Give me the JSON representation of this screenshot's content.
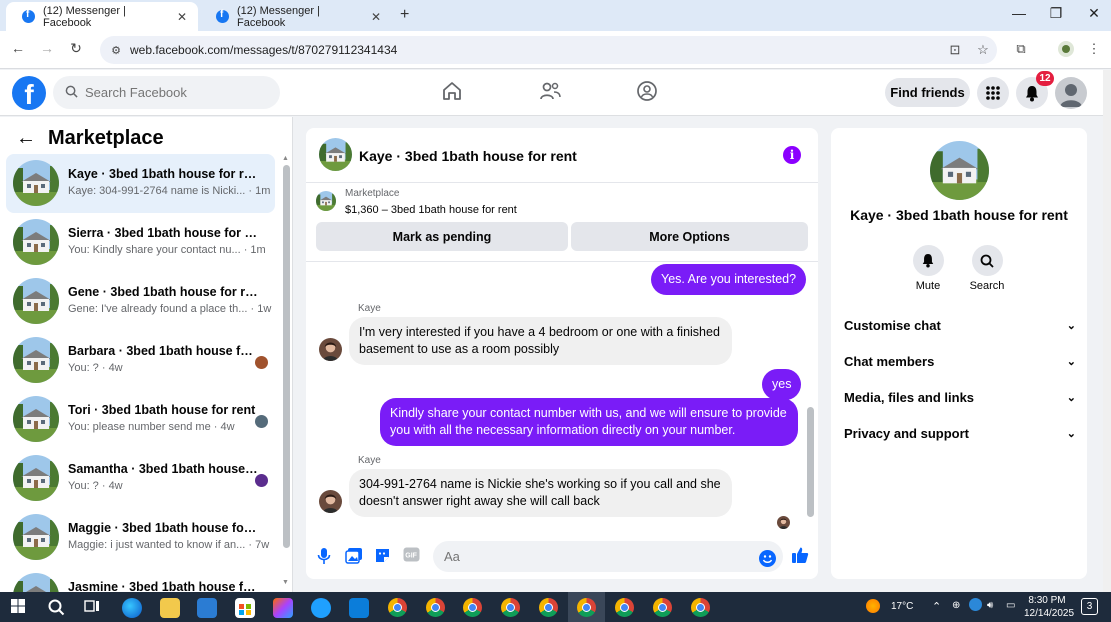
{
  "browser": {
    "tabs": [
      {
        "title": "(12) Messenger | Facebook",
        "close": "✕"
      },
      {
        "title": "(12) Messenger | Facebook",
        "close": "✕"
      }
    ],
    "new_tab": "+",
    "url": "web.facebook.com/messages/t/870279112341434",
    "window_controls": {
      "minimize": "—",
      "restore": "❐",
      "close": "✕"
    }
  },
  "header": {
    "logo": "f",
    "search_placeholder": "Search Facebook",
    "find_friends": "Find friends",
    "notifications_count": "12"
  },
  "sidebar": {
    "title": "Marketplace",
    "conversations": [
      {
        "name": "Kaye · 3bed 1bath house for rent",
        "snippet": "Kaye: 304-991-2764 name is Nicki... · 1m",
        "selected": true
      },
      {
        "name": "Sierra · 3bed 1bath house for rent",
        "snippet": "You: Kindly share your contact nu... · 1m"
      },
      {
        "name": "Gene · 3bed 1bath house for rent",
        "snippet": "Gene: I've already found a place th... · 1w"
      },
      {
        "name": "Barbara · 3bed 1bath house fo...",
        "snippet": "You: ? · 4w",
        "seen_color": "#a0522d"
      },
      {
        "name": "Tori · 3bed 1bath house for rent",
        "snippet": "You: please number send me · 4w",
        "seen_color": "#556b7a"
      },
      {
        "name": "Samantha · 3bed 1bath house ...",
        "snippet": "You: ? · 4w",
        "seen_color": "#5b2d8e"
      },
      {
        "name": "Maggie · 3bed 1bath house for r...",
        "snippet": "Maggie: i just wanted to know if an... · 7w"
      },
      {
        "name": "Jasmine · 3bed 1bath house fo...",
        "snippet": "",
        "seen_color": "#6b4a3a"
      }
    ]
  },
  "chat": {
    "title": "Kaye · 3bed 1bath house for rent",
    "info_icon": "i",
    "marketplace_label": "Marketplace",
    "listing": "$1,360 – 3bed 1bath house for rent",
    "mark_pending": "Mark as pending",
    "more_options": "More Options",
    "messages": [
      {
        "dir": "out",
        "text": "Yes. Are you interested?"
      },
      {
        "dir": "in",
        "sender": "Kaye",
        "text": "I'm very interested if you have a 4 bedroom or one with a finished basement to use as a room possibly"
      },
      {
        "dir": "out",
        "text": "yes"
      },
      {
        "dir": "out",
        "text": "Kindly share your contact number with us, and we will ensure to provide you with all the necessary information directly on your number."
      },
      {
        "dir": "in",
        "sender": "Kaye",
        "text": "304-991-2764 name is Nickie she's working so if you call and she doesn't answer right away she will call back"
      }
    ],
    "input_placeholder": "Aa"
  },
  "info_panel": {
    "title": "Kaye · 3bed 1bath house for rent",
    "mute": "Mute",
    "search": "Search",
    "rows": [
      "Customise chat",
      "Chat members",
      "Media, files and links",
      "Privacy and support"
    ]
  },
  "taskbar": {
    "weather": "17°C",
    "time": "8:30 PM",
    "date": "12/14/2025",
    "notifications": "3"
  },
  "colors": {
    "accent": "#1877f2",
    "outgoing_bubble": "#7a1cf7",
    "badge": "#e41e3f"
  }
}
